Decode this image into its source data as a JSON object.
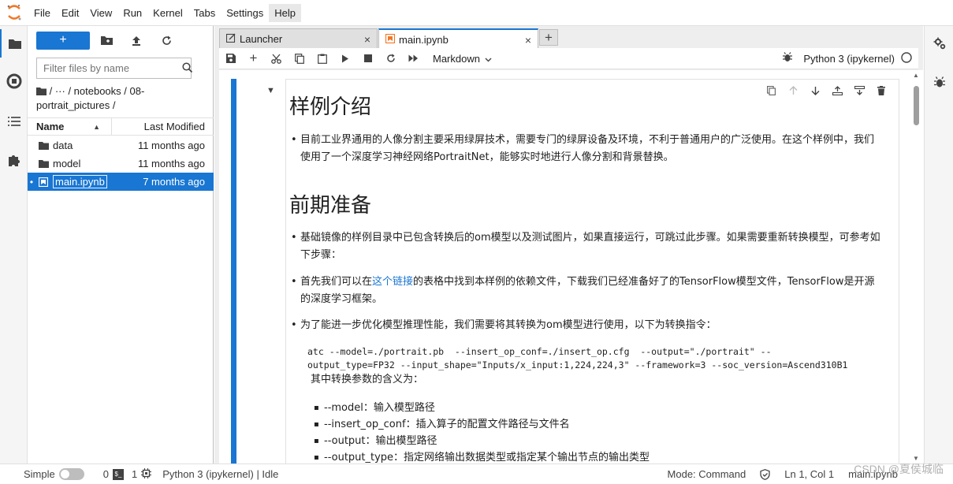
{
  "menubar": {
    "items": [
      "File",
      "Edit",
      "View",
      "Run",
      "Kernel",
      "Tabs",
      "Settings",
      "Help"
    ],
    "active_item": "Help"
  },
  "filebrowser": {
    "new_label": "+",
    "search_placeholder": "Filter files by name",
    "breadcrumb": "/  ···  / notebooks / 08-portrait_pictures /",
    "col_name": "Name",
    "col_modified": "Last Modified",
    "rows": [
      {
        "name": "data",
        "modified": "11 months ago",
        "type": "folder"
      },
      {
        "name": "model",
        "modified": "11 months ago",
        "type": "folder"
      },
      {
        "name": "main.ipynb",
        "modified": "7 months ago",
        "type": "notebook",
        "selected": true
      }
    ]
  },
  "tabs": [
    {
      "label": "Launcher",
      "close": "×"
    },
    {
      "label": "main.ipynb",
      "close": "×"
    }
  ],
  "tab_add": "+",
  "nbtoolbar": {
    "cell_type": "Markdown",
    "kernel_name": "Python 3 (ipykernel)"
  },
  "notebook": {
    "h1_intro": "样例介绍",
    "intro_bullet": "目前工业界通用的人像分割主要采用绿屏技术，需要专门的绿屏设备及环境，不利于普通用户的广泛使用。在这个样例中，我们使用了一个深度学习神经网络PortraitNet，能够实时地进行人像分割和背景替换。",
    "h1_prep": "前期准备",
    "prep_bullet_1": "基础镜像的样例目录中已包含转换后的om模型以及测试图片，如果直接运行，可跳过此步骤。如果需要重新转换模型，可参考如下步骤：",
    "prep_bullet_2_pre": "首先我们可以在",
    "prep_bullet_2_link": "这个链接",
    "prep_bullet_2_post": "的表格中找到本样例的依赖文件，下载我们已经准备好了的TensorFlow模型文件，TensorFlow是开源的深度学习框架。",
    "prep_bullet_3": "为了能进一步优化模型推理性能，我们需要将其转换为om模型进行使用，以下为转换指令：",
    "code_line_1": "atc --model=./portrait.pb  --insert_op_conf=./insert_op.cfg  --output=\"./portrait\" --",
    "code_line_2": "output_type=FP32 --input_shape=\"Inputs/x_input:1,224,224,3\" --framework=3 --soc_version=Ascend310B1",
    "params_intro": "其中转换参数的含义为：",
    "params": [
      "--model：输入模型路径",
      "--insert_op_conf：插入算子的配置文件路径与文件名",
      "--output：输出模型路径",
      "--output_type：指定网络输出数据类型或指定某个输出节点的输出类型"
    ]
  },
  "statusbar": {
    "mode_label": "Simple",
    "terminals_count": "0",
    "kernels_count": "1",
    "kernel_status": "Python 3 (ipykernel) | Idle",
    "mode": "Mode: Command",
    "position": "Ln 1, Col 1",
    "file": "main.ipynb",
    "watermark": "CSDN @夏侯城临"
  },
  "colors": {
    "accent": "#1976d2",
    "menu_active": "#e8e8e8"
  }
}
